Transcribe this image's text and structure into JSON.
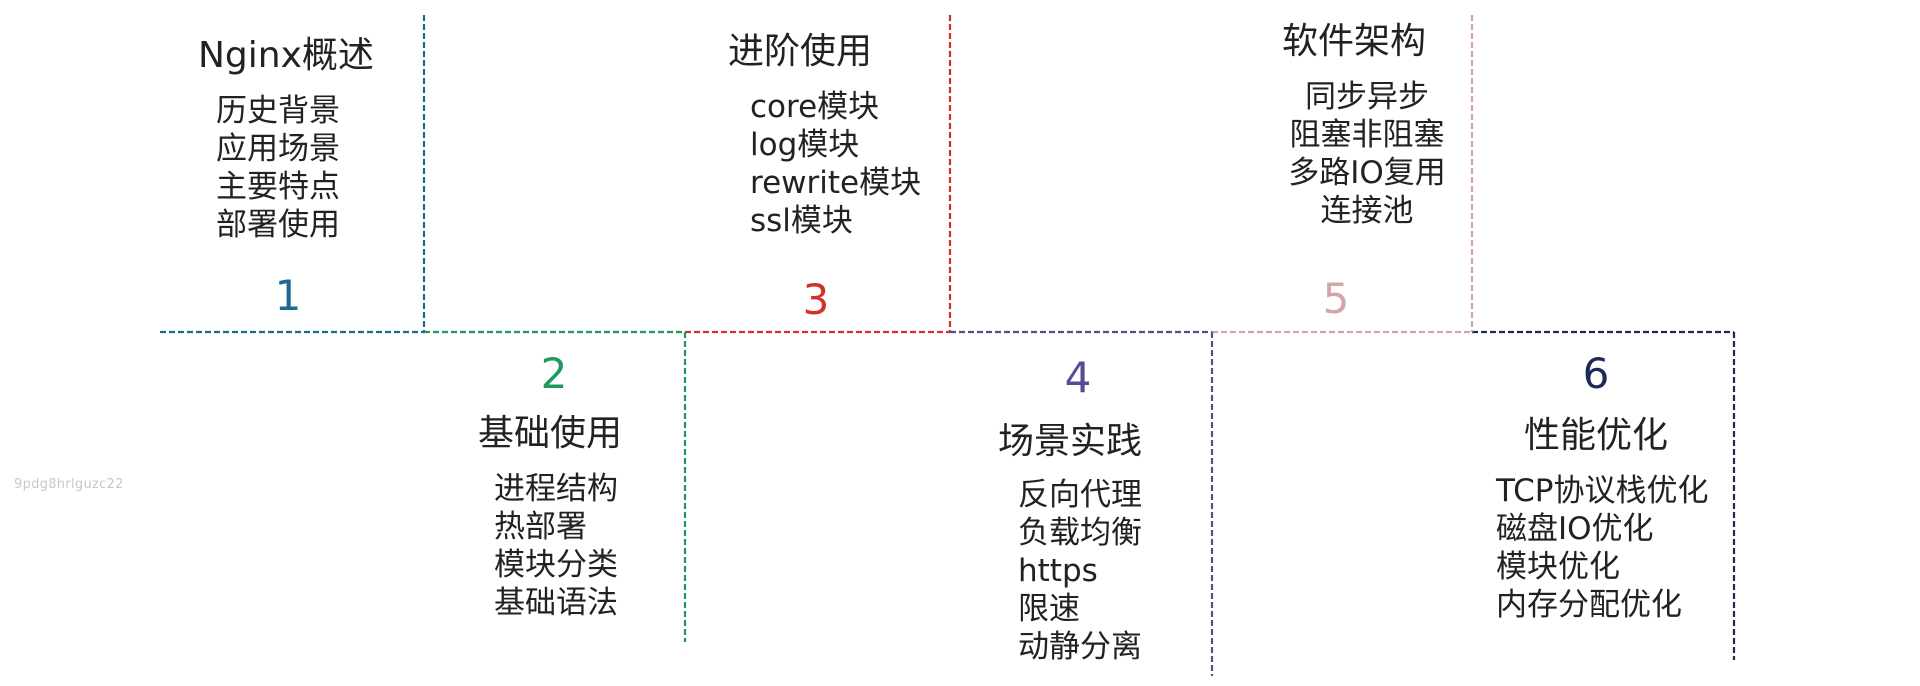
{
  "watermark": "9pdg8hrlguzc22",
  "sections": [
    {
      "number": "1",
      "color": "#1b6a94",
      "title": "Nginx概述",
      "items": [
        "历史背景",
        "应用场景",
        "主要特点",
        "部署使用"
      ]
    },
    {
      "number": "2",
      "color": "#1e9a5e",
      "title": "基础使用",
      "items": [
        "进程结构",
        "热部署",
        "模块分类",
        "基础语法"
      ]
    },
    {
      "number": "3",
      "color": "#d2302a",
      "title": "进阶使用",
      "items": [
        "core模块",
        "log模块",
        "rewrite模块",
        "ssl模块"
      ]
    },
    {
      "number": "4",
      "color": "#5a4a94",
      "title": "场景实践",
      "items": [
        "反向代理",
        "负载均衡",
        "https",
        "限速",
        "动静分离"
      ]
    },
    {
      "number": "5",
      "color": "#d4a4a8",
      "title": "软件架构",
      "items": [
        "同步异步",
        "阻塞非阻塞",
        "多路IO复用",
        "连接池"
      ]
    },
    {
      "number": "6",
      "color": "#1d2a55",
      "title": "性能优化",
      "items": [
        "TCP协议栈优化",
        "磁盘IO优化",
        "模块优化",
        "内存分配优化"
      ]
    }
  ]
}
